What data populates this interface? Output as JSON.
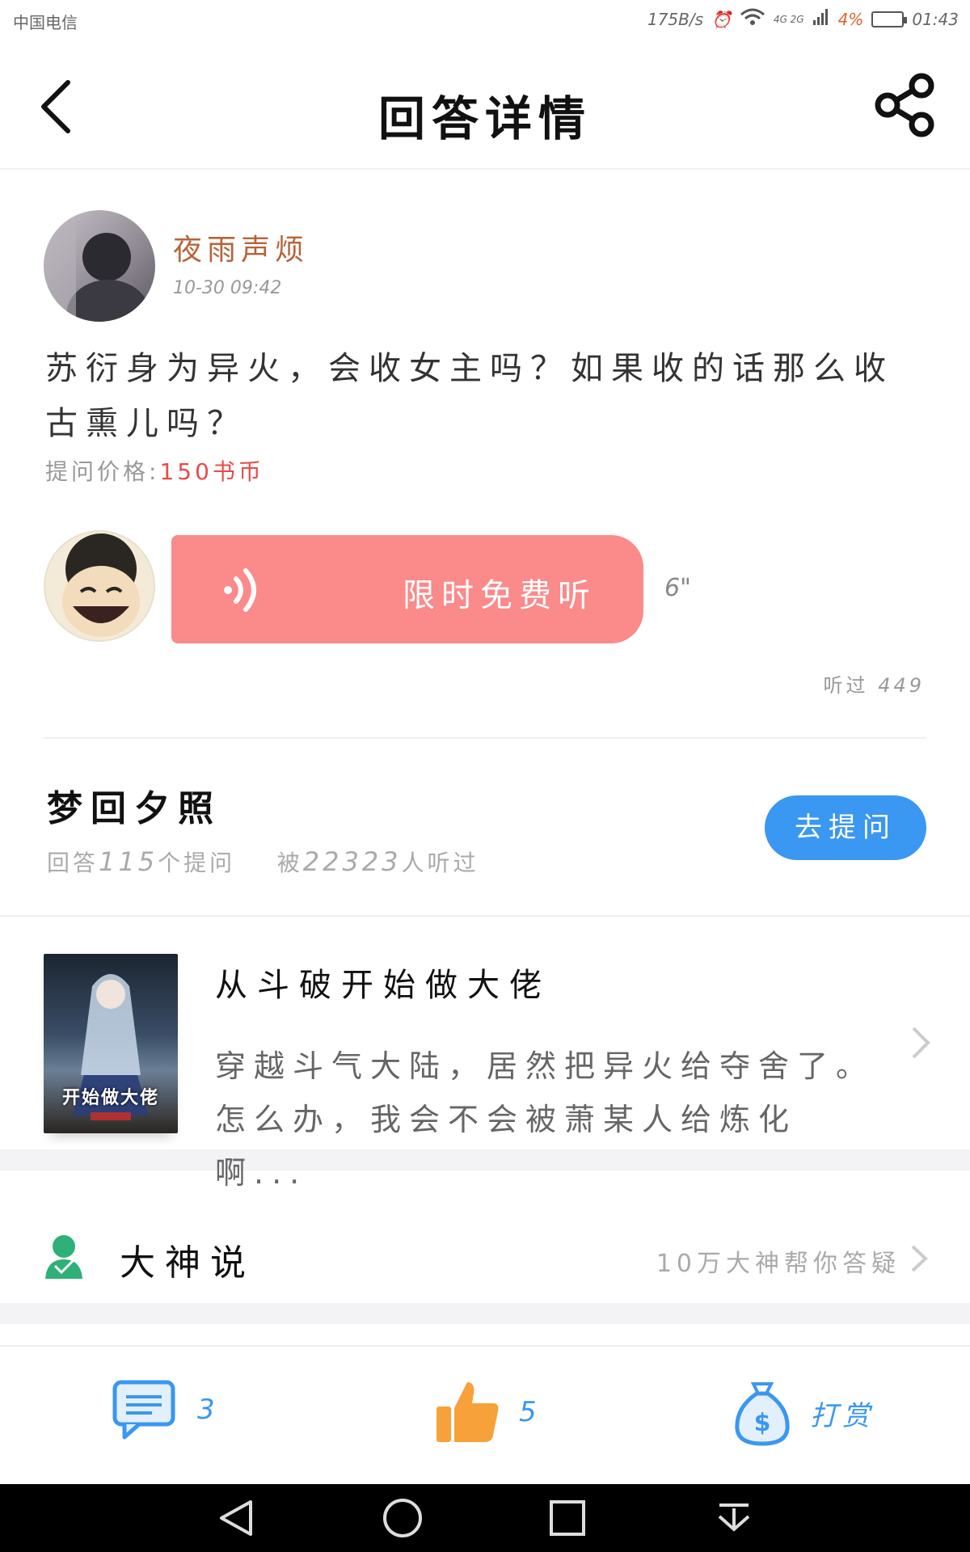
{
  "status_bar": {
    "carrier": "中国电信",
    "net_speed": "175B/s",
    "network": "4G 2G",
    "battery_pct": "4%",
    "time": "01:43"
  },
  "nav": {
    "title": "回答详情"
  },
  "question": {
    "asker_name": "夜雨声烦",
    "time": "10-30 09:42",
    "text": "苏衍身为异火，会收女主吗？如果收的话那么收古熏儿吗？",
    "price_label": "提问价格:",
    "price_value": "150书币"
  },
  "answer": {
    "audio_label": "限时免费听",
    "duration": "6\"",
    "listened_label": "听过",
    "listened_count": "449"
  },
  "answerer": {
    "name": "梦回夕照",
    "stats_answer_prefix": "回答",
    "answer_count": "115",
    "stats_answer_suffix": "个提问",
    "stats_listen_prefix": "被",
    "listen_count": "22323",
    "stats_listen_suffix": "人听过",
    "ask_button": "去提问"
  },
  "book": {
    "cover_text": "开始做大佬",
    "title": "从斗破开始做大佬",
    "desc": "穿越斗气大陆，居然把异火给夺舍了。怎么办，我会不会被萧某人给炼化啊..."
  },
  "dashen": {
    "title": "大神说",
    "tagline": "10万大神帮你答疑"
  },
  "bottom_bar": {
    "comment_count": "3",
    "like_count": "5",
    "reward_label": "打赏"
  },
  "colors": {
    "accent": "#3a97f2",
    "audio": "#fb8a8a",
    "name_brown": "#b6643a",
    "price_red": "#e84a4a",
    "like_orange": "#f7a13a"
  }
}
